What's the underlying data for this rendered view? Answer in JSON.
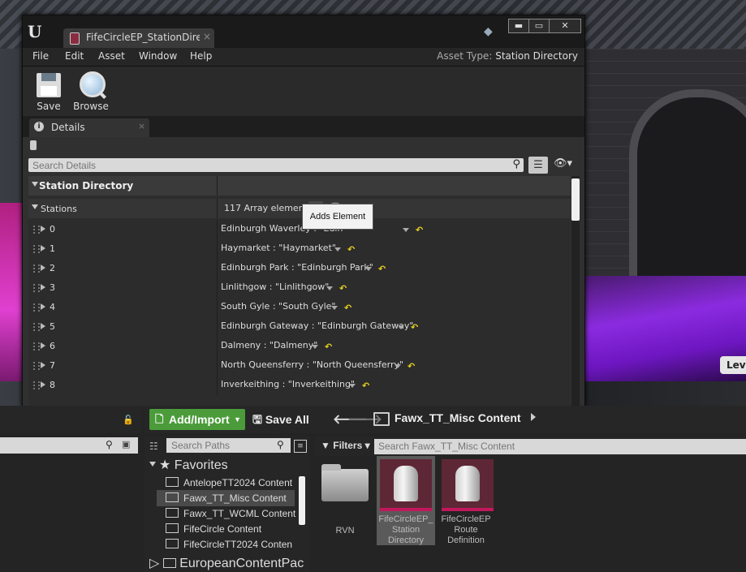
{
  "window": {
    "tab_title": "FifeCircleEP_StationDirectory",
    "tab_close": "×",
    "menus": [
      "File",
      "Edit",
      "Asset",
      "Window",
      "Help"
    ],
    "asset_type_label": "Asset Type:",
    "asset_type_value": "Station Directory",
    "controls": {
      "minimize": "▬",
      "maximize": "▭",
      "close": "✕"
    }
  },
  "toolbar": {
    "save_label": "Save",
    "browse_label": "Browse"
  },
  "details": {
    "tab_label": "Details",
    "tab_close": "×",
    "search_placeholder": "Search Details",
    "category": "Station Directory",
    "array_name": "Stations",
    "array_count": "117 Array elements",
    "tooltip": "Adds Element",
    "items": [
      {
        "index": "0",
        "value": "Edinburgh Waverley : \"Edin"
      },
      {
        "index": "1",
        "value": "Haymarket : \"Haymarket\""
      },
      {
        "index": "2",
        "value": "Edinburgh Park : \"Edinburgh Park\""
      },
      {
        "index": "3",
        "value": "Linlithgow : \"Linlithgow\""
      },
      {
        "index": "4",
        "value": "South Gyle : \"South Gyle\""
      },
      {
        "index": "5",
        "value": "Edinburgh Gateway : \"Edinburgh Gateway\""
      },
      {
        "index": "6",
        "value": "Dalmeny : \"Dalmeny\""
      },
      {
        "index": "7",
        "value": "North Queensferry : \"North Queensferry\""
      },
      {
        "index": "8",
        "value": "Inverkeithing : \"Inverkeithing\""
      }
    ]
  },
  "content_browser": {
    "add_import": "Add/Import",
    "save_all": "Save All",
    "current_path": "Fawx_TT_Misc Content",
    "paths_search_placeholder": "Search Paths",
    "favorites_label": "Favorites",
    "favorites": [
      "AntelopeTT2024 Content",
      "Fawx_TT_Misc Content",
      "Fawx_TT_WCML Content",
      "FifeCircle Content",
      "FifeCircleTT2024 Conten"
    ],
    "european": "EuropeanContentPac",
    "filters_label": "Filters",
    "asset_search_placeholder": "Search Fawx_TT_Misc Content",
    "assets": [
      {
        "name": "RVN"
      },
      {
        "name": "FifeCircleEP_ Station Directory"
      },
      {
        "name": "FifeCircleEP Route Definition"
      }
    ]
  },
  "viewport": {
    "badge": "Leve"
  }
}
